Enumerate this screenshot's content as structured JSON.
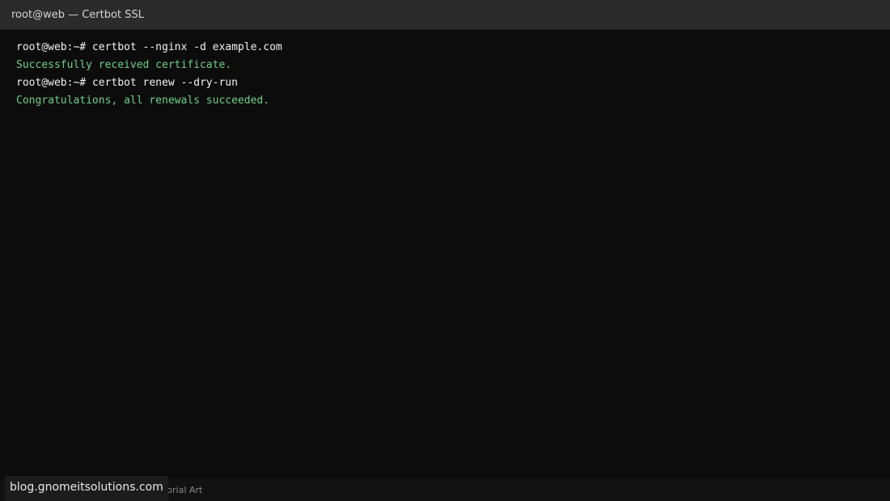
{
  "window": {
    "title": "root@web — Certbot SSL"
  },
  "terminal": {
    "lines": [
      {
        "text": "root@web:~# certbot --nginx -d example.com",
        "kind": "command"
      },
      {
        "text": "Successfully received certificate.",
        "kind": "success"
      },
      {
        "text": "root@web:~# certbot renew --dry-run",
        "kind": "command"
      },
      {
        "text": "Congratulations, all renewals succeeded.",
        "kind": "success"
      }
    ]
  },
  "statusbar": {
    "text": "utorial Art"
  },
  "watermark": {
    "text": "blog.gnomeitsolutions.com"
  },
  "colors": {
    "background": "#0c0c0c",
    "titlebar": "#2b2b2b",
    "command_text": "#f2f2f2",
    "success_text": "#6fcf8a"
  }
}
